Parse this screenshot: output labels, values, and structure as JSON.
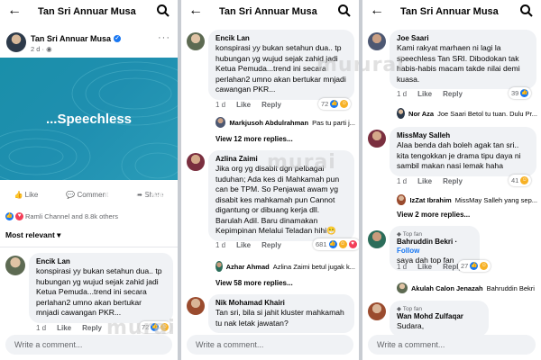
{
  "app": {
    "title": "Tan Sri Annuar Musa",
    "watermark": "murai"
  },
  "panel1": {
    "poster": "Tan Sri Annuar Musa",
    "time": "2 d",
    "post_image_text": "...Speechless",
    "actions": {
      "like": "Like",
      "comment": "Comment",
      "share": "Share"
    },
    "reactions_text": "Ramli Channel and 8.8k others",
    "sort": "Most relevant",
    "comment": {
      "name": "Encik Lan",
      "text": "konspirasi yy bukan setahun dua.. tp hubungan yg wujud sejak zahid jadi Ketua Pemuda...trend ini secara perlahan2 umno  akan bertukar mnjadi cawangan PKR...",
      "time": "1 d",
      "like": "Like",
      "reply": "Reply",
      "count": "72"
    },
    "write_placeholder": "Write a comment..."
  },
  "panel2": {
    "c1": {
      "name": "Encik Lan",
      "text": "konspirasi yy bukan setahun dua.. tp hubungan yg wujud sejak zahid jadi Ketua Pemuda...trend ini secara perlahan2 umno  akan bertukar mnjadi cawangan PKR...",
      "time": "1 d",
      "like": "Like",
      "reply": "Reply",
      "count": "72"
    },
    "r1": {
      "name": "Markjusoh Abdulrahman",
      "text": "Pas tu parti j..."
    },
    "view1": "View 12 more replies...",
    "c2": {
      "name": "Azlina Zaimi",
      "text": "Jika org yg disabit dgn pelbagai tuduhan; Ada kes di Mahkamah pun can be TPM. So Penjawat awam yg disabit kes mahkamah pun Cannot digantung or dibuang kerja dll. Barulah Adil. Baru dinamakan Kepimpinan Melalui Teladan hihi😁",
      "time": "1 d",
      "like": "Like",
      "reply": "Reply",
      "count": "681"
    },
    "r2": {
      "name": "Azhar Ahmad",
      "text": "Azlina Zaimi betul jugak k..."
    },
    "view2": "View 58 more replies...",
    "c3": {
      "name": "Nik Mohamad Khairi",
      "text": "Tan sri, bila si jahit kluster mahkamah tu nak letak jawatan?"
    },
    "write_placeholder": "Write a comment..."
  },
  "panel3": {
    "c1": {
      "name": "Joe Saari",
      "text": "Kami rakyat marhaen ni lagi la speechless Tan SRI. Dibodokan tak habis-habis macam takde nilai demi kuasa.",
      "time": "1 d",
      "like": "Like",
      "reply": "Reply",
      "count": "39"
    },
    "r1": {
      "name": "Nor Aza",
      "text": "Joe Saari Betol tu tuan. Dulu Pr..."
    },
    "c2": {
      "name": "MissMay Salleh",
      "text": "Alaa benda dah boleh agak tan sri.. kita tengokkan je drama tipu daya ni sambil makan nasi lemak haha",
      "time": "1 d",
      "like": "Like",
      "reply": "Reply",
      "count": "41"
    },
    "r2": {
      "name": "IzZat Ibrahim",
      "text": "MissMay Salleh yang sep..."
    },
    "view2": "View 2 more replies...",
    "c3": {
      "badge": "Top fan",
      "name": "Bahruddin Bekri",
      "follow": "Follow",
      "text": "saya dah top fan",
      "time": "1 d",
      "like": "Like",
      "reply": "Reply",
      "count": "27"
    },
    "r3": {
      "name": "Akulah Calon Jenazah",
      "text": "Bahruddin Bekri"
    },
    "c4": {
      "badge": "Top fan",
      "name": "Wan Mohd Zulfaqar",
      "text": "Sudara,"
    },
    "write_placeholder": "Write a comment..."
  }
}
